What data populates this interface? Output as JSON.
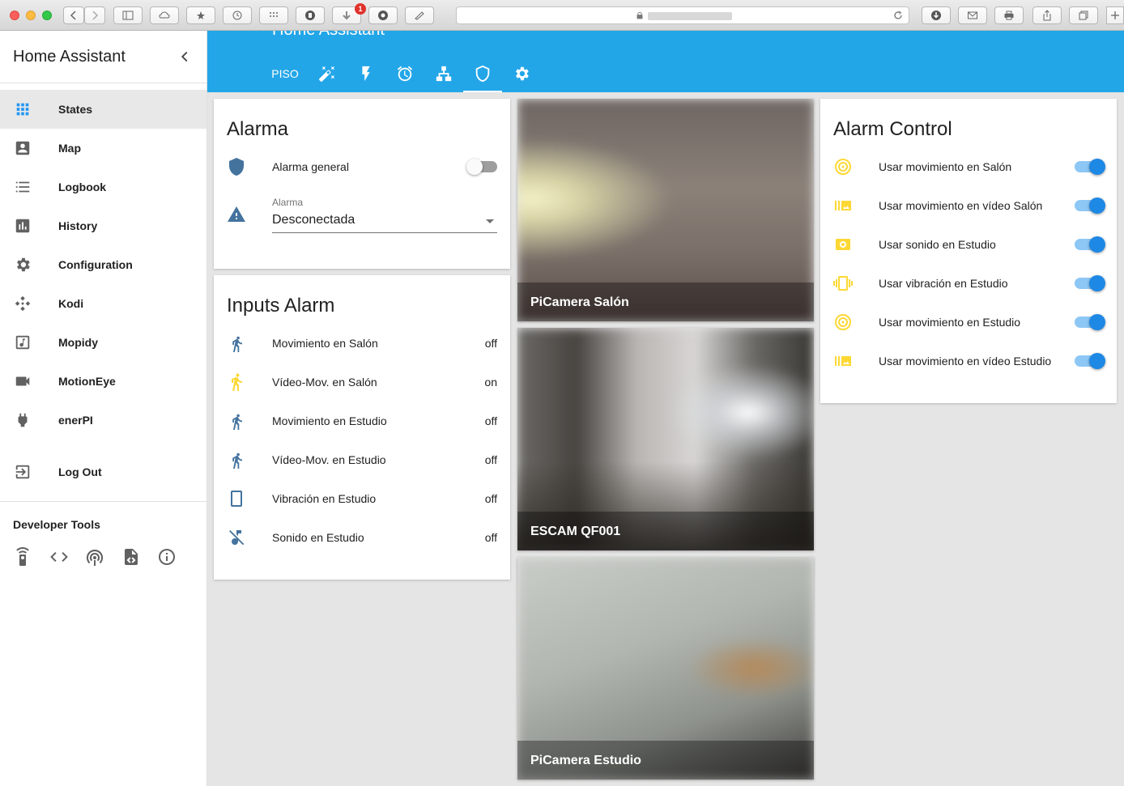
{
  "browser": {
    "notification_count": "1"
  },
  "sidebar": {
    "title": "Home Assistant",
    "items": [
      {
        "label": "States",
        "icon": "apps-grid-icon"
      },
      {
        "label": "Map",
        "icon": "account-box-icon"
      },
      {
        "label": "Logbook",
        "icon": "format-list-icon"
      },
      {
        "label": "History",
        "icon": "poll-box-icon"
      },
      {
        "label": "Configuration",
        "icon": "settings-icon"
      },
      {
        "label": "Kodi",
        "icon": "kodi-icon"
      },
      {
        "label": "Mopidy",
        "icon": "music-note-icon"
      },
      {
        "label": "MotionEye",
        "icon": "video-camera-icon"
      },
      {
        "label": "enerPI",
        "icon": "power-plug-icon"
      }
    ],
    "logout_label": "Log Out",
    "dev_tools_title": "Developer Tools"
  },
  "toolbar": {
    "title": "Home Assistant",
    "tab_text": "PISO",
    "accent_color": "#23a6e8"
  },
  "alarma_card": {
    "title": "Alarma",
    "switch_label": "Alarma general",
    "select_label": "Alarma",
    "select_value": "Desconectada"
  },
  "inputs_card": {
    "title": "Inputs Alarm",
    "rows": [
      {
        "label": "Movimiento en Salón",
        "value": "off"
      },
      {
        "label": "Vídeo-Mov. en Salón",
        "value": "on"
      },
      {
        "label": "Movimiento en Estudio",
        "value": "off"
      },
      {
        "label": "Vídeo-Mov. en Estudio",
        "value": "off"
      },
      {
        "label": "Vibración en Estudio",
        "value": "off"
      },
      {
        "label": "Sonido en Estudio",
        "value": "off"
      }
    ]
  },
  "cameras": [
    {
      "caption": "PiCamera Salón"
    },
    {
      "caption": "ESCAM QF001"
    },
    {
      "caption": "PiCamera Estudio"
    }
  ],
  "control_card": {
    "title": "Alarm Control",
    "rows": [
      {
        "label": "Usar movimiento en Salón",
        "icon": "target-icon"
      },
      {
        "label": "Usar movimiento en vídeo Salón",
        "icon": "image-filter-icon"
      },
      {
        "label": "Usar sonido en Estudio",
        "icon": "speaker-icon"
      },
      {
        "label": "Usar vibración en Estudio",
        "icon": "vibrate-icon"
      },
      {
        "label": "Usar movimiento en Estudio",
        "icon": "target-icon"
      },
      {
        "label": "Usar movimiento en vídeo Estudio",
        "icon": "image-filter-icon"
      }
    ]
  }
}
